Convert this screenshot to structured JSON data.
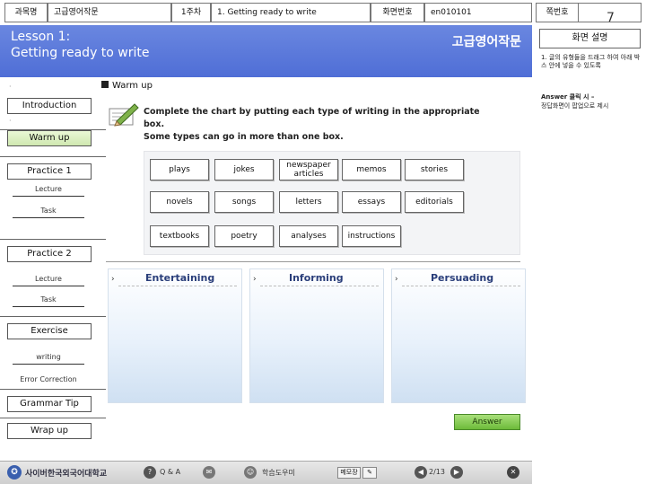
{
  "topbar": {
    "course_label": "과목명",
    "course_value": "고급영어작문",
    "week_label": "1주차",
    "lesson_value": "1. Getting ready to write",
    "screen_label": "화면번호",
    "screen_value": "en010101",
    "page_label": "쪽번호",
    "page_number": "7"
  },
  "header": {
    "lesson_title": "Lesson 1:\nGetting ready to write",
    "course_title": "고급영어작문"
  },
  "description": {
    "heading": "화면 설명",
    "item1": "1. 글의 유형들을 드래그 하여 아래 박스 안에 넣을 수 있도록",
    "item2_bold": "Answer 클릭 시 –",
    "item2_rest": "정답화면이 팝업으로 제시"
  },
  "nav": {
    "introduction": "Introduction",
    "warm_up": "Warm up",
    "practice1": "Practice 1",
    "p1_lecture": "Lecture",
    "p1_task": "Task",
    "practice2": "Practice 2",
    "p2_lecture": "Lecture",
    "p2_task": "Task",
    "exercise": "Exercise",
    "writing": "writing",
    "error_correction": "Error Correction",
    "grammar_tip": "Grammar Tip",
    "wrap_up": "Wrap up"
  },
  "main": {
    "section_label": "Warm up",
    "instruction_line1": "Complete the chart by putting each type of writing in the appropriate box.",
    "instruction_line2": "Some types can go in more than one box.",
    "words": [
      "plays",
      "jokes",
      "newspaper articles",
      "memos",
      "stories",
      "novels",
      "songs",
      "letters",
      "essays",
      "editorials",
      "textbooks",
      "poetry",
      "analyses",
      "instructions"
    ],
    "categories": [
      "Entertaining",
      "Informing",
      "Persuading"
    ],
    "answer_button": "Answer"
  },
  "footer": {
    "logo_text": "사이버한국외국어대학교",
    "qa_label": "Q & A",
    "help_label": "학습도우미",
    "notes_label": "메모장",
    "page_indicator": "2/13"
  }
}
